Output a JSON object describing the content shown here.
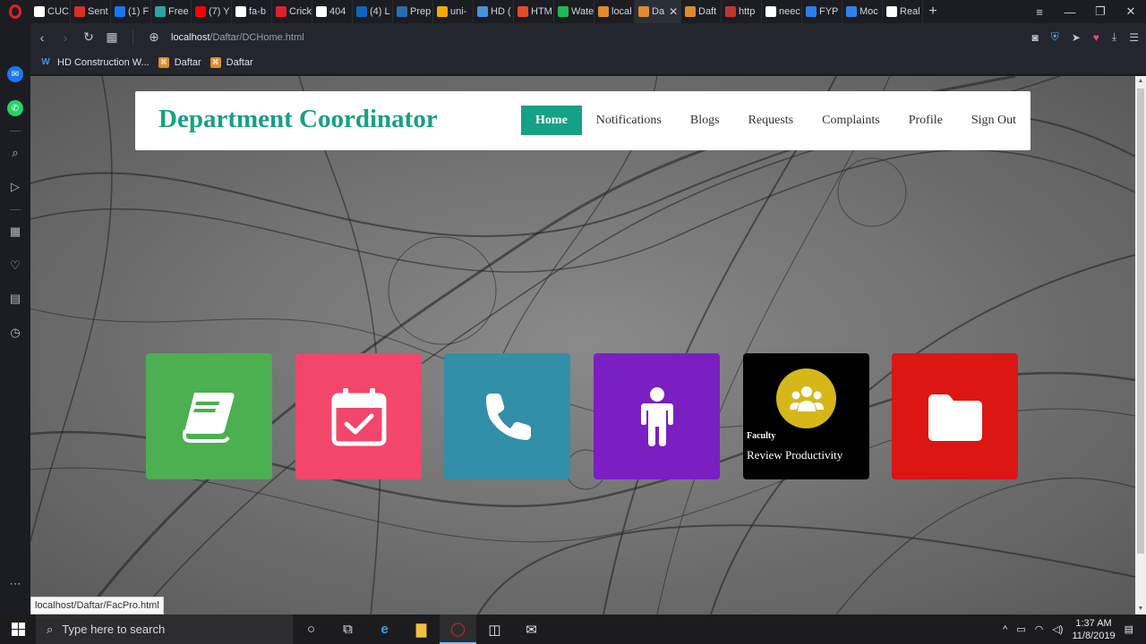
{
  "browser": {
    "tabs": [
      {
        "label": "CUC",
        "icon": "cu-icon",
        "color": "#ffffff"
      },
      {
        "label": "Sent",
        "icon": "gmail-icon",
        "color": "#d93025"
      },
      {
        "label": "(1) F",
        "icon": "facebook-icon",
        "color": "#1877f2"
      },
      {
        "label": "Free",
        "icon": "fiverr-icon",
        "color": "#2aa7a3"
      },
      {
        "label": "(7) Y",
        "icon": "youtube-icon",
        "color": "#ff0000"
      },
      {
        "label": "fa-b",
        "icon": "flag-icon",
        "color": "#ffffff"
      },
      {
        "label": "Crick",
        "icon": "cricket-icon",
        "color": "#e0202a"
      },
      {
        "label": "404",
        "icon": "file-icon",
        "color": "#ffffff"
      },
      {
        "label": "(4) L",
        "icon": "linkedin-icon",
        "color": "#0a66c2"
      },
      {
        "label": "Prep",
        "icon": "d-icon",
        "color": "#2b6cb0"
      },
      {
        "label": "uni-",
        "icon": "pin-icon",
        "color": "#f2a900"
      },
      {
        "label": "HD (",
        "icon": "wm-icon",
        "color": "#4a8fe0"
      },
      {
        "label": "HTM",
        "icon": "html-icon",
        "color": "#e34c26"
      },
      {
        "label": "Wate",
        "icon": "wattpad-icon",
        "color": "#1db954"
      },
      {
        "label": "local",
        "icon": "xampp-icon",
        "color": "#e08a2e"
      },
      {
        "label": "Da",
        "icon": "xampp-icon",
        "color": "#e08a2e",
        "active": true
      },
      {
        "label": "Daft",
        "icon": "xampp-icon",
        "color": "#e08a2e"
      },
      {
        "label": "http",
        "icon": "shield-icon",
        "color": "#c0392b"
      },
      {
        "label": "neec",
        "icon": "google-icon",
        "color": "#ffffff"
      },
      {
        "label": "FYP",
        "icon": "f-icon",
        "color": "#2b7de9"
      },
      {
        "label": "Moc",
        "icon": "m-icon",
        "color": "#2f80ed"
      },
      {
        "label": "Real",
        "icon": "google-icon",
        "color": "#ffffff"
      }
    ],
    "url_host": "localhost",
    "url_path": "/Daftar/DCHome.html",
    "bookmarks": [
      {
        "label": "HD Construction W...",
        "icon": "wm-icon"
      },
      {
        "label": "Daftar",
        "icon": "xampp-icon"
      },
      {
        "label": "Daftar",
        "icon": "xampp-icon"
      }
    ],
    "status_url": "localhost/Daftar/FacPro.html"
  },
  "site": {
    "title": "Department Coordinator",
    "nav": [
      {
        "label": "Home",
        "active": true
      },
      {
        "label": "Notifications"
      },
      {
        "label": "Blogs"
      },
      {
        "label": "Requests"
      },
      {
        "label": "Complaints"
      },
      {
        "label": "Profile"
      },
      {
        "label": "Sign Out"
      }
    ],
    "accent": "#16a085"
  },
  "tiles": [
    {
      "name": "book",
      "color": "#4caf50",
      "icon": "book-icon"
    },
    {
      "name": "calendar",
      "color": "#f2466a",
      "icon": "calendar-check-icon"
    },
    {
      "name": "phone",
      "color": "#328fa8",
      "icon": "phone-icon"
    },
    {
      "name": "person",
      "color": "#7a1fc2",
      "icon": "person-icon"
    },
    {
      "name": "faculty",
      "color": "#000000",
      "icon": "users-icon",
      "circle_color": "#d6b71a",
      "caption_small": "Faculty",
      "caption_big": "Review Productivity"
    },
    {
      "name": "folder",
      "color": "#dc1515",
      "icon": "folder-icon"
    }
  ],
  "taskbar": {
    "search_placeholder": "Type here to search",
    "time": "1:37 AM",
    "date": "11/8/2019"
  }
}
